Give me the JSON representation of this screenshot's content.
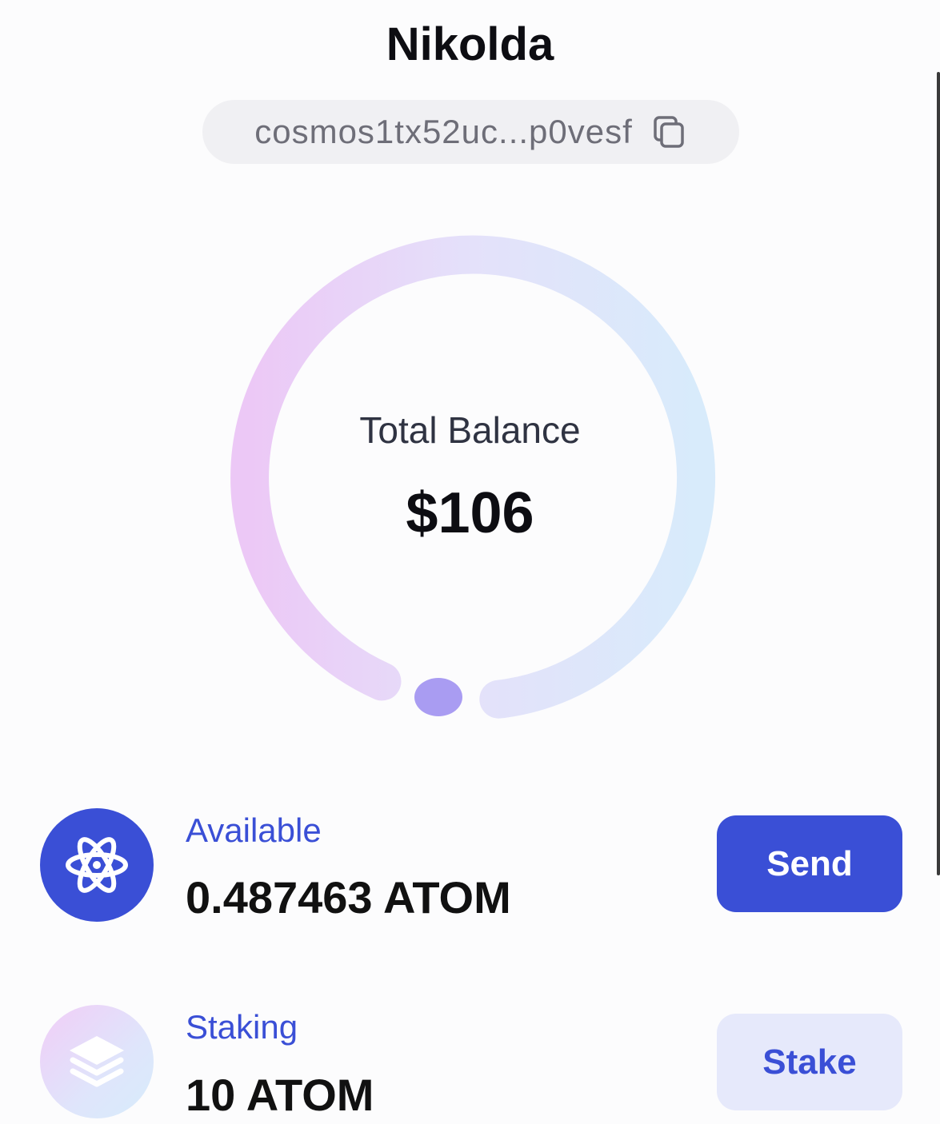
{
  "header": {
    "title": "Nikolda"
  },
  "address": {
    "short": "cosmos1tx52uc...p0vesf",
    "copy_icon": "copy-icon"
  },
  "balance": {
    "label": "Total Balance",
    "value": "$106",
    "ring_colors": [
      "#ecc8f6",
      "#e4e1fa",
      "#d8ebfb"
    ],
    "indicator_color": "#a99cf2"
  },
  "assets": [
    {
      "label": "Available",
      "amount": "0.487463 ATOM",
      "icon": "atom-icon",
      "action": "Send"
    },
    {
      "label": "Staking",
      "amount": "10 ATOM",
      "icon": "layers-icon",
      "action": "Stake"
    }
  ],
  "colors": {
    "accent": "#3a4fd6",
    "accent_light": "#e6e9fb",
    "text_primary": "#0d0d12",
    "text_muted": "#6e6e78"
  }
}
